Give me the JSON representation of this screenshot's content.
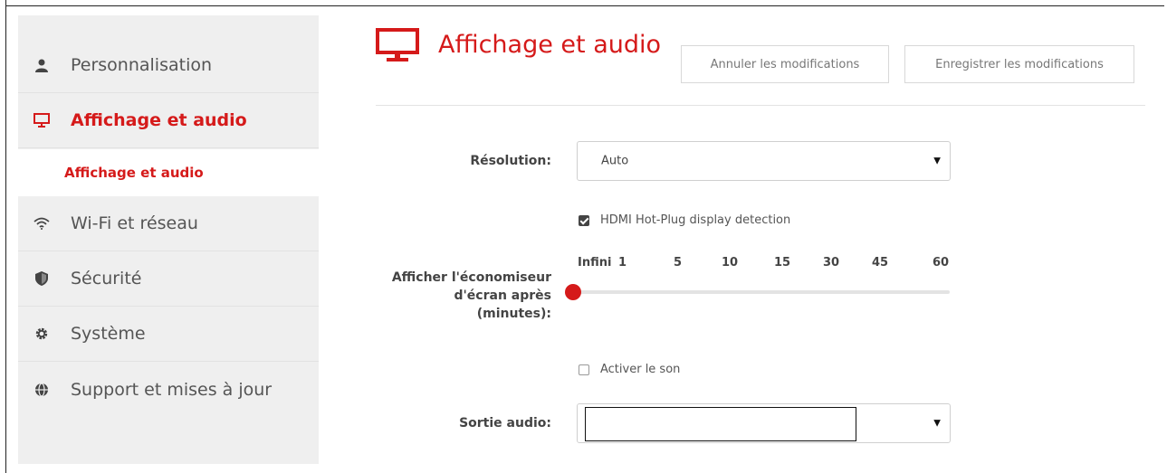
{
  "sidebar": {
    "items": [
      {
        "label": "Personnalisation",
        "icon": "person-icon"
      },
      {
        "label": "Affichage et audio",
        "icon": "monitor-icon",
        "active": true
      },
      {
        "label": "Affichage et audio",
        "icon": "",
        "sub": true
      },
      {
        "label": "Wi-Fi et réseau",
        "icon": "wifi-icon"
      },
      {
        "label": "Sécurité",
        "icon": "shield-icon"
      },
      {
        "label": "Système",
        "icon": "gear-icon"
      },
      {
        "label": "Support et mises à jour",
        "icon": "globe-icon"
      }
    ]
  },
  "header": {
    "title": "Affichage et audio",
    "icon": "monitor-icon",
    "cancel_label": "Annuler les modifications",
    "save_label": "Enregistrer les modifications"
  },
  "form": {
    "resolution": {
      "label": "Résolution:",
      "value": "Auto"
    },
    "hdmi": {
      "label": "HDMI Hot-Plug display detection",
      "checked": true
    },
    "screensaver": {
      "label_lines": [
        "Afficher l'économiseur",
        "d'écran après",
        "(minutes):"
      ],
      "ticks": [
        "Infini",
        "1",
        "5",
        "10",
        "15",
        "30",
        "45",
        "60"
      ],
      "selected_index": 0
    },
    "sound": {
      "label": "Activer le son",
      "checked": false
    },
    "audio_output": {
      "label": "Sortie audio:",
      "value": ""
    }
  },
  "colors": {
    "accent": "#d51a1a",
    "sidebar_bg": "#efefef"
  }
}
